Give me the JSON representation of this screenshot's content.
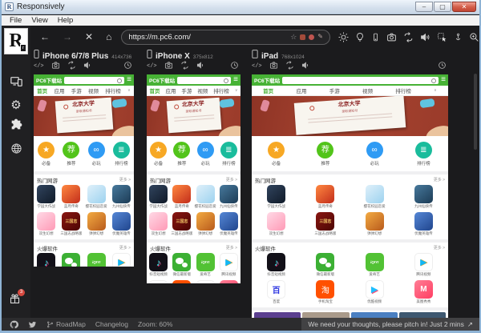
{
  "window": {
    "title": "Responsively",
    "menu": [
      "File",
      "View",
      "Help"
    ]
  },
  "glyphs": {
    "back": "←",
    "forward": "→",
    "stop": "✕",
    "home": "⌂",
    "star": "☆",
    "edit": "✎",
    "burger": "≡",
    "chevron": "∨",
    "min": "–",
    "max": "▢",
    "close": "✕",
    "ext": "↗",
    "code": "</>"
  },
  "toolbar": {
    "url": "https://m.pc6.com/"
  },
  "sidebar": {
    "gift_badge": "3"
  },
  "devices": [
    {
      "name": "iPhone 6/7/8 Plus",
      "size": "414x736"
    },
    {
      "name": "iPhone X",
      "size": "375x812"
    },
    {
      "name": "iPad",
      "size": "768x1024"
    }
  ],
  "site": {
    "brand": "PC6下载站",
    "nav": [
      "首页",
      "应用",
      "手游",
      "视频",
      "排行榜"
    ],
    "banner": {
      "title": "北京大学",
      "subtitle": "录取通知书"
    },
    "quick": [
      {
        "label": "必备",
        "glyph": "★",
        "color": "#f7a824"
      },
      {
        "label": "推荐",
        "glyph": "荐",
        "color": "#52c41a"
      },
      {
        "label": "必玩",
        "glyph": "∞",
        "color": "#2f9bf4"
      },
      {
        "label": "排行榜",
        "glyph": "≣",
        "color": "#1abc9c"
      }
    ],
    "sections": [
      {
        "title": "热门网游",
        "more": "更多 >",
        "rows": [
          [
            {
              "label": "学园大作战",
              "skin": "g1"
            },
            {
              "label": "蓝月传奇",
              "skin": "g2"
            },
            {
              "label": "樱花校园恋爱",
              "skin": "g3"
            },
            {
              "label": "九州仙侠传",
              "skin": "g4"
            }
          ],
          [
            {
              "label": "双生幻想",
              "skin": "g5"
            },
            {
              "label": "三国志战略版",
              "skin": "g6",
              "glyph": "三国志"
            },
            {
              "label": "弹弹幻想",
              "skin": "g7"
            },
            {
              "label": "伏魔英雄传",
              "skin": "g8"
            }
          ]
        ]
      },
      {
        "title": "火爆软件",
        "more": "更多 >",
        "rows": [
          [
            {
              "label": "抖音短视频",
              "skin": "douyin",
              "glyph": "♪"
            },
            {
              "label": "微信最新版",
              "skin": "wechat",
              "glyph": ""
            },
            {
              "label": "爱奇艺",
              "skin": "iqiyi",
              "glyph": "iQIYI"
            },
            {
              "label": "腾讯视频",
              "skin": "tencent",
              "glyph": "▶"
            }
          ],
          [
            {
              "label": "百度",
              "skin": "baidu",
              "glyph": "百"
            },
            {
              "label": "手机淘宝",
              "skin": "taobao",
              "glyph": "淘"
            },
            {
              "label": "优酷视频",
              "skin": "youku",
              "glyph": "▶"
            },
            {
              "label": "美图秀秀",
              "skin": "meitu",
              "glyph": "M"
            }
          ]
        ]
      }
    ],
    "strip_colors": [
      "#5b3f8f",
      "#a99a8a",
      "#4a7fc1",
      "#3e5870"
    ]
  },
  "statusbar": {
    "roadmap": "RoadMap",
    "changelog": "Changelog",
    "zoom": "Zoom: 60%",
    "feedback": "We need your thoughts, please pitch in! Just 2 mins"
  }
}
